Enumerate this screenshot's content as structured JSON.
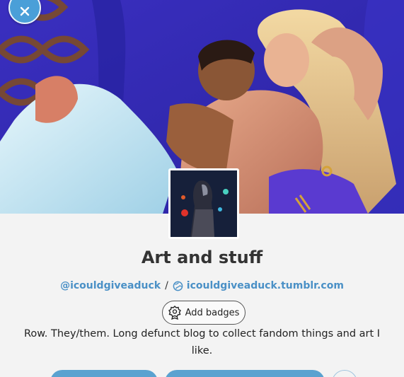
{
  "profile": {
    "title": "Art and stuff",
    "username": "@icouldgiveaduck",
    "separator": "/",
    "blog_url": "icouldgiveaduck.tumblr.com",
    "description": "Row. They/them. Long defunct blog to collect fandom things and art I like."
  },
  "badges": {
    "label": "Add badges"
  },
  "icons": {
    "close": "close-icon",
    "globe": "globe-icon",
    "badge": "badge-icon"
  },
  "colors": {
    "accent": "#4a90c6",
    "button": "#5aa2d0",
    "header_bg": "#2f2fae"
  }
}
